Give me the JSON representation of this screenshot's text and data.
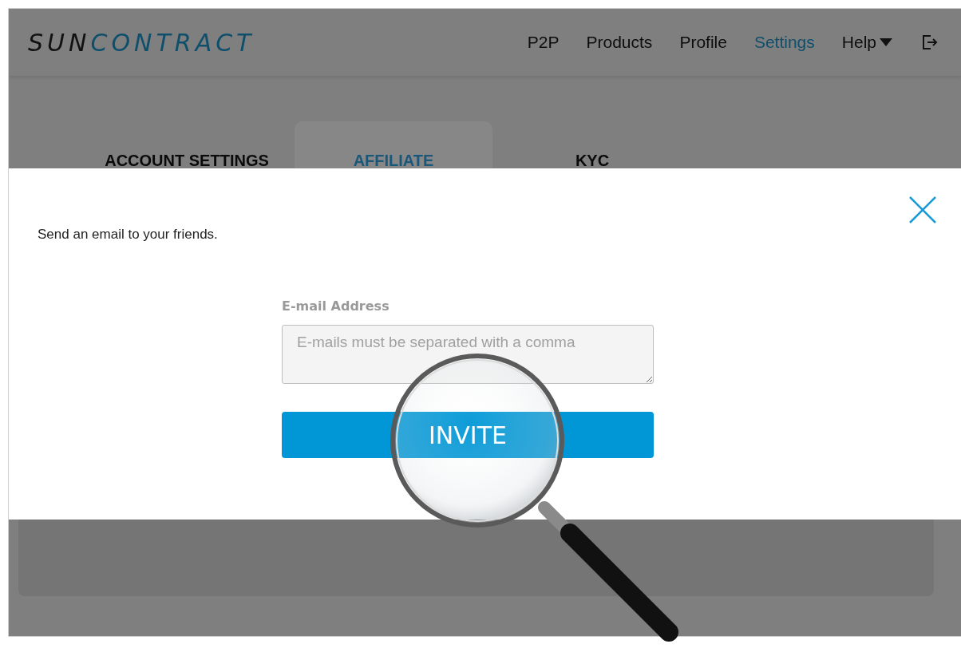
{
  "logo": {
    "first": "SUN",
    "second": "CONTRACT"
  },
  "nav": [
    {
      "label": "P2P",
      "selected": false
    },
    {
      "label": "Products",
      "selected": false
    },
    {
      "label": "Profile",
      "selected": false
    },
    {
      "label": "Settings",
      "selected": true
    },
    {
      "label": "Help",
      "selected": false,
      "kind": "dropdown"
    },
    {
      "kind": "logout",
      "selected": false
    }
  ],
  "tabs": [
    {
      "label": "ACCOUNT SETTINGS",
      "selected": false
    },
    {
      "label": "AFFILIATE",
      "selected": true
    },
    {
      "label": "KYC",
      "selected": false
    }
  ],
  "modal": {
    "message": "Send an email to your friends.",
    "field_label": "E-mail Address",
    "placeholder": "E-mails must be separated with a comma",
    "button": "INVITE"
  }
}
